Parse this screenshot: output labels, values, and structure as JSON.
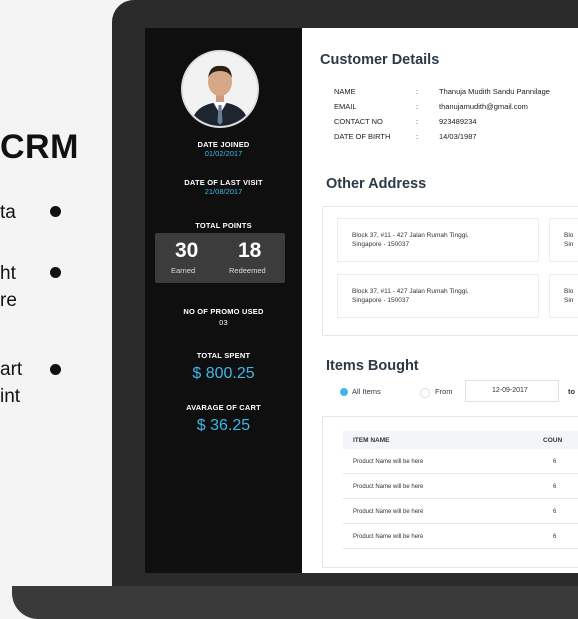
{
  "page": {
    "background_title": "CRM",
    "bullet_fragments": [
      {
        "lines": [
          "ta"
        ]
      },
      {
        "lines": [
          "ht",
          "re"
        ]
      },
      {
        "lines": [
          "art",
          "int"
        ]
      }
    ]
  },
  "profile": {
    "date_joined_label": "DATE JOINED",
    "date_joined": "01/02/2017",
    "last_visit_label": "DATE OF LAST VISIT",
    "last_visit": "21/08/2017",
    "total_points_label": "TOTAL POINTS",
    "earned_value": "30",
    "earned_label": "Earned",
    "redeemed_value": "18",
    "redeemed_label": "Redeemed",
    "promo_label": "NO OF PROMO USED",
    "promo_value": "03",
    "total_spent_label": "TOTAL SPENT",
    "total_spent": "$ 800.25",
    "avg_cart_label": "AVARAGE OF CART",
    "avg_cart": "$ 36.25"
  },
  "customer_details": {
    "title": "Customer Details",
    "rows": [
      {
        "key": "NAME",
        "sep": ":",
        "value": "Thanuja Mudith Sandu Pannilage"
      },
      {
        "key": "EMAIL",
        "sep": ":",
        "value": "thanujamudith@gmail.com"
      },
      {
        "key": "CONTACT NO",
        "sep": ":",
        "value": "923489234"
      },
      {
        "key": "DATE OF BIRTH",
        "sep": ":",
        "value": "14/03/1987"
      }
    ]
  },
  "other_address": {
    "title": "Other Address",
    "cards": [
      {
        "line1": "Block 37, #11 - 427 Jalan Rumah Tinggi,",
        "line2": "Singapore - 150037"
      },
      {
        "line1": "Block 37, #11 - 427 Jalan Rumah Tinggi,",
        "line2": "Singapore - 150037"
      }
    ],
    "partial_cards": [
      {
        "line1": "Blo",
        "line2": "Sin"
      },
      {
        "line1": "Blo",
        "line2": "Sin"
      }
    ]
  },
  "items_bought": {
    "title": "Items Bought",
    "all_items_label": "All Items",
    "from_label": "From",
    "from_date": "12-09-2017",
    "to_label": "to",
    "col_item_name": "ITEM NAME",
    "col_count": "COUN",
    "rows": [
      {
        "name": "Product Name will be here",
        "count": "6"
      },
      {
        "name": "Product Name will be here",
        "count": "6"
      },
      {
        "name": "Product Name will be here",
        "count": "6"
      },
      {
        "name": "Product Name will be here",
        "count": "6"
      }
    ]
  },
  "colors": {
    "accent": "#3fb6ea",
    "sidebar_bg": "#0f0f0f",
    "heading": "#2d3a46"
  }
}
